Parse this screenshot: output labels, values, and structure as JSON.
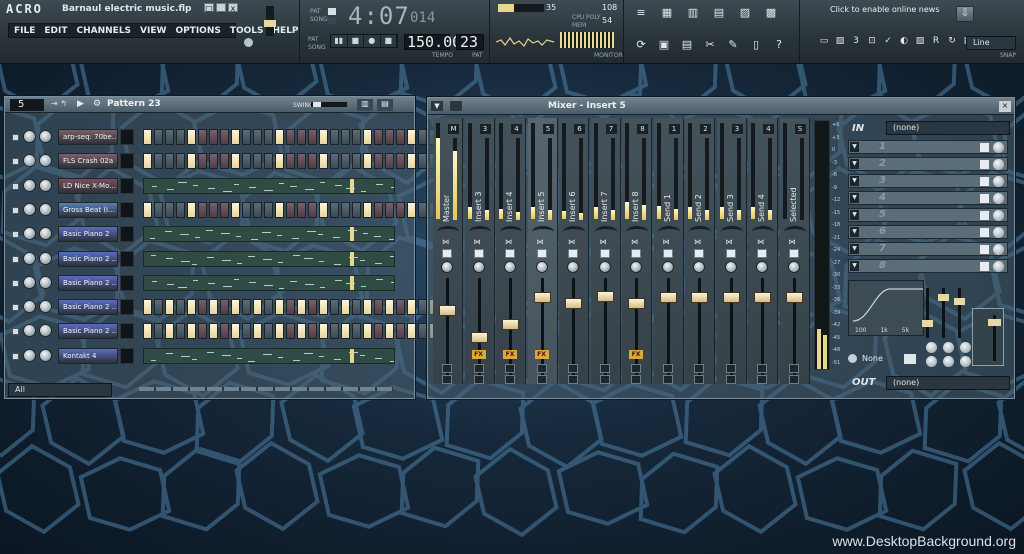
{
  "app": {
    "logo": "ACRO",
    "project_title": "Barnaul electric music.flp",
    "win_buttons": [
      "□",
      "_",
      "x"
    ]
  },
  "menu": [
    "FILE",
    "EDIT",
    "CHANNELS",
    "VIEW",
    "OPTIONS",
    "TOOLS",
    "HELP"
  ],
  "top": {
    "song_time_big": "4:07",
    "song_time_small": "014",
    "pat_label": "PAT",
    "song_label": "SONG",
    "tempo": "150.000",
    "tempo_label": "TEMPO",
    "pattern_num": "23",
    "pattern_label": "PAT",
    "cpu": "35",
    "mem": "108",
    "poly": "54",
    "cpu_label": "CPU",
    "mem_label": "MEM",
    "poly_label": "POLY",
    "monitor_label": "MONITOR",
    "news_text": "Click to enable online news",
    "snap_value": "Line",
    "snap_label": "SNAP"
  },
  "pattern_window": {
    "channel_num": "5",
    "pattern_name": "Pattern 23",
    "swing_label": "SWING",
    "filter_value": "All",
    "channels": [
      {
        "name": "arp-seq: 70be...",
        "mode": "steps",
        "color": "#7a5f69",
        "steps": [
          1,
          0,
          0,
          0,
          1,
          0,
          0,
          0,
          1,
          0,
          0,
          0,
          1,
          0,
          0,
          0,
          1,
          0,
          0,
          0,
          1,
          0,
          0,
          0,
          1,
          0,
          0,
          0
        ]
      },
      {
        "name": "FLS Crash 02a",
        "mode": "steps",
        "color": "#7a5f69",
        "steps": [
          1,
          0,
          0,
          0,
          1,
          0,
          0,
          0,
          1,
          0,
          0,
          0,
          1,
          0,
          0,
          0,
          1,
          0,
          0,
          0,
          1,
          0,
          0,
          0,
          1,
          0,
          0,
          0
        ]
      },
      {
        "name": "LD Nice X-Mo...",
        "mode": "roll",
        "color": "#7a4f5c",
        "steps": []
      },
      {
        "name": "Gross Beat (I...",
        "mode": "steps",
        "color": "#5b7bb8",
        "steps": [
          1,
          0,
          0,
          0,
          1,
          0,
          0,
          0,
          1,
          0,
          0,
          0,
          1,
          0,
          0,
          0,
          1,
          0,
          0,
          0,
          1,
          0,
          0,
          0,
          1,
          0,
          0,
          0
        ]
      },
      {
        "name": "Basic Piano 2",
        "mode": "roll",
        "color": "#5b6cc2",
        "steps": []
      },
      {
        "name": "Basic Piano 2 ...",
        "mode": "roll",
        "color": "#5b6cc2",
        "steps": []
      },
      {
        "name": "Basic Piano 2 ...",
        "mode": "roll",
        "color": "#5b6cc2",
        "steps": []
      },
      {
        "name": "Basic Piano 2 ...",
        "mode": "steps",
        "color": "#5b6cc2",
        "steps": [
          1,
          0,
          1,
          0,
          1,
          0,
          1,
          0,
          1,
          0,
          1,
          0,
          1,
          0,
          1,
          0,
          1,
          0,
          1,
          0,
          1,
          0,
          1,
          0,
          1,
          0,
          1,
          0
        ]
      },
      {
        "name": "Basic Piano 2 ...",
        "mode": "steps",
        "color": "#5b6cc2",
        "steps": [
          1,
          0,
          1,
          0,
          1,
          0,
          1,
          0,
          1,
          0,
          1,
          0,
          1,
          0,
          1,
          0,
          1,
          0,
          1,
          0,
          1,
          0,
          1,
          0,
          1,
          0,
          1,
          0
        ]
      },
      {
        "name": "Kontakt 4",
        "mode": "roll",
        "color": "#5b6cc2",
        "steps": []
      }
    ]
  },
  "mixer": {
    "title": "Mixer - Insert 5",
    "in_label": "IN",
    "in_value": "(none)",
    "out_label": "OUT",
    "out_value": "(none)",
    "eq_preset": "None",
    "eq_labels": [
      "100",
      "1k",
      "5k"
    ],
    "tracks": [
      {
        "name": "Master",
        "num": "M",
        "level": 0.84,
        "fader": 0.3,
        "fx": false,
        "selected": false
      },
      {
        "name": "Insert 3",
        "num": "3",
        "level": 0.12,
        "fader": 0.6,
        "fx": true,
        "selected": false
      },
      {
        "name": "Insert 4",
        "num": "4",
        "level": 0.1,
        "fader": 0.45,
        "fx": true,
        "selected": false
      },
      {
        "name": "Insert 5",
        "num": "5",
        "level": 0.12,
        "fader": 0.15,
        "fx": true,
        "selected": true
      },
      {
        "name": "Insert 6",
        "num": "6",
        "level": 0.08,
        "fader": 0.22,
        "fx": false,
        "selected": false
      },
      {
        "name": "Insert 7",
        "num": "7",
        "level": 0.12,
        "fader": 0.14,
        "fx": false,
        "selected": false
      },
      {
        "name": "Insert 8",
        "num": "8",
        "level": 0.18,
        "fader": 0.22,
        "fx": true,
        "selected": false
      },
      {
        "name": "Send 1",
        "num": "1",
        "level": 0.14,
        "fader": 0.16,
        "fx": false,
        "selected": false
      },
      {
        "name": "Send 2",
        "num": "2",
        "level": 0.12,
        "fader": 0.16,
        "fx": false,
        "selected": false
      },
      {
        "name": "Send 3",
        "num": "3",
        "level": 0.12,
        "fader": 0.16,
        "fx": false,
        "selected": false
      },
      {
        "name": "Send 4",
        "num": "4",
        "level": 0.12,
        "fader": 0.16,
        "fx": false,
        "selected": false
      },
      {
        "name": "Selected",
        "num": "S",
        "level": 0.0,
        "fader": 0.16,
        "fx": false,
        "selected": false
      }
    ],
    "db_scale": [
      "+6",
      "+3",
      "0",
      "-3",
      "-6",
      "-9",
      "-12",
      "-15",
      "-18",
      "-21",
      "-24",
      "-27",
      "-30",
      "-33",
      "-36",
      "-39",
      "-42",
      "-45",
      "-48",
      "-51"
    ],
    "slots": [
      "1",
      "2",
      "3",
      "4",
      "5",
      "6",
      "7",
      "8"
    ]
  },
  "watermark": "www.DesktopBackground.org"
}
